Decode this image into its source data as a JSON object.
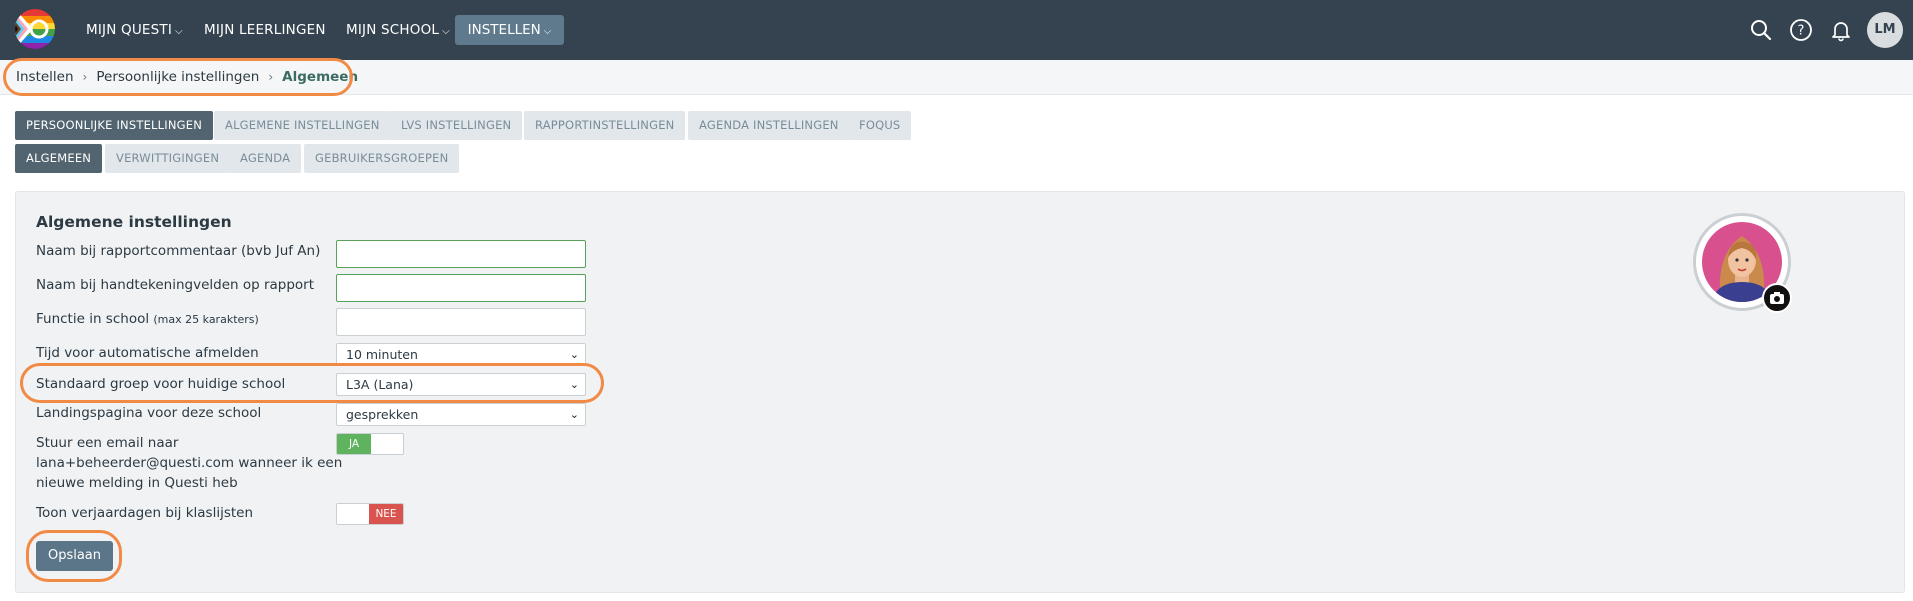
{
  "nav": {
    "items": [
      {
        "label": "MIJN QUESTI",
        "has_dropdown": true
      },
      {
        "label": "MIJN LEERLINGEN",
        "has_dropdown": false
      },
      {
        "label": "MIJN SCHOOL",
        "has_dropdown": true
      },
      {
        "label": "INSTELLEN",
        "has_dropdown": true
      }
    ],
    "avatar_initials": "LM",
    "icons": [
      "search-icon",
      "help-icon",
      "bell-icon"
    ]
  },
  "breadcrumb": [
    "Instellen",
    "Persoonlijke instellingen",
    "Algemeen"
  ],
  "tabs_primary": [
    "PERSOONLIJKE INSTELLINGEN",
    "ALGEMENE INSTELLINGEN",
    "LVS INSTELLINGEN",
    "RAPPORTINSTELLINGEN",
    "AGENDA INSTELLINGEN",
    "FOQUS"
  ],
  "tabs_secondary": [
    "ALGEMEEN",
    "VERWITTIGINGEN",
    "AGENDA",
    "GEBRUIKERSGROEPEN"
  ],
  "form": {
    "title": "Algemene instellingen",
    "fields": {
      "name_report": {
        "label": "Naam bij rapportcommentaar (bvb Juf An)",
        "value": ""
      },
      "name_signature": {
        "label": "Naam bij handtekeningvelden op rapport",
        "value": ""
      },
      "function": {
        "label": "Functie in school",
        "hint": "(max 25 karakters)",
        "value": ""
      },
      "auto_logout": {
        "label": "Tijd voor automatische afmelden",
        "value": "10 minuten"
      },
      "default_group": {
        "label": "Standaard groep voor huidige school",
        "value": "L3A (Lana)"
      },
      "landing_page": {
        "label": "Landingspagina voor deze school",
        "value": "gesprekken"
      },
      "email_notify": {
        "label_lines": [
          "Stuur een email naar",
          "lana+beheerder@questi.com wanneer ik een",
          "nieuwe melding in Questi heb"
        ],
        "value": "JA"
      },
      "show_birthdays": {
        "label": "Toon verjaardagen bij klaslijsten",
        "value": "NEE"
      }
    },
    "save_label": "Opslaan"
  },
  "colors": {
    "nav_bg": "#34434f",
    "accent": "#f08a45",
    "toggle_on": "#5fb35f",
    "toggle_off": "#d9534f"
  }
}
